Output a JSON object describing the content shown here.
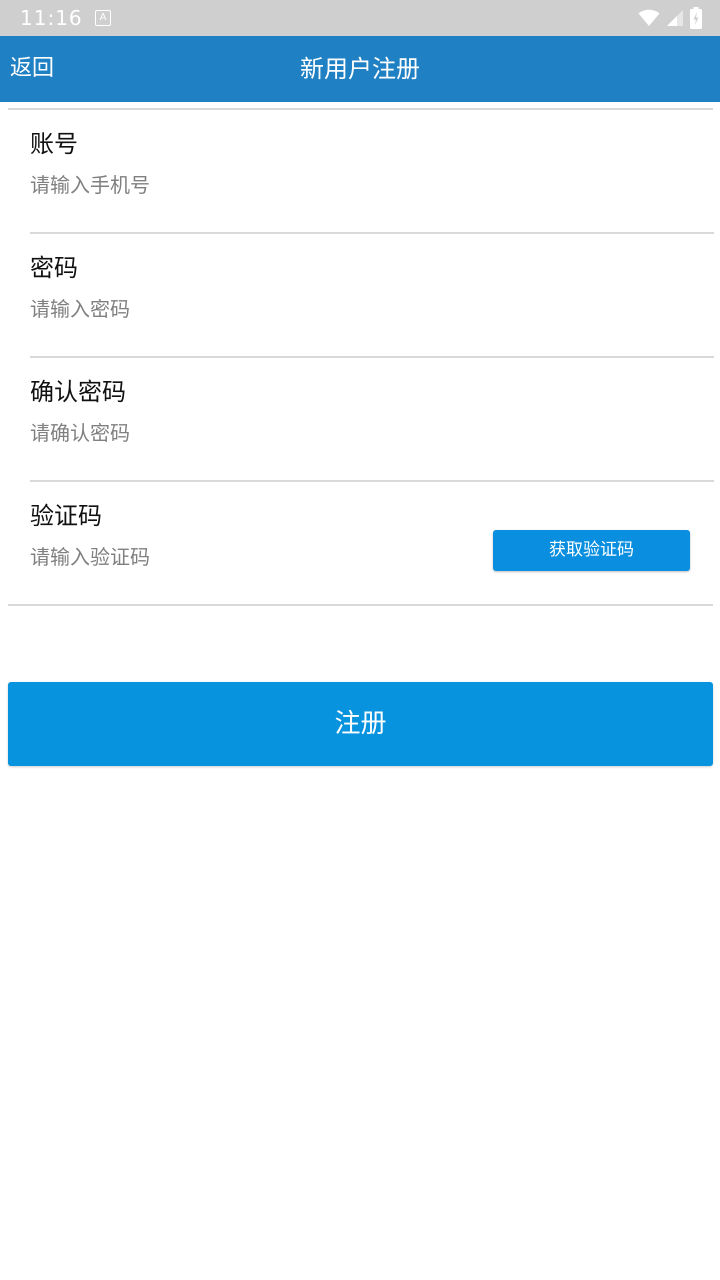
{
  "status_bar": {
    "time": "11:16",
    "notification_icon": "a-letter-icon",
    "wifi_icon": "wifi-icon",
    "signal_icon": "cell-signal-icon",
    "battery_icon": "battery-charging-icon"
  },
  "app_bar": {
    "back_label": "返回",
    "title": "新用户注册",
    "color": "#2080c4"
  },
  "form": {
    "account": {
      "label": "账号",
      "value": "",
      "placeholder": "请输入手机号"
    },
    "password": {
      "label": "密码",
      "value": "",
      "placeholder": "请输入密码"
    },
    "confirm_password": {
      "label": "确认密码",
      "value": "",
      "placeholder": "请确认密码"
    },
    "verification_code": {
      "label": "验证码",
      "value": "",
      "placeholder": "请输入验证码",
      "get_code_label": "获取验证码"
    }
  },
  "register_button": {
    "label": "注册",
    "color": "#0893de"
  }
}
